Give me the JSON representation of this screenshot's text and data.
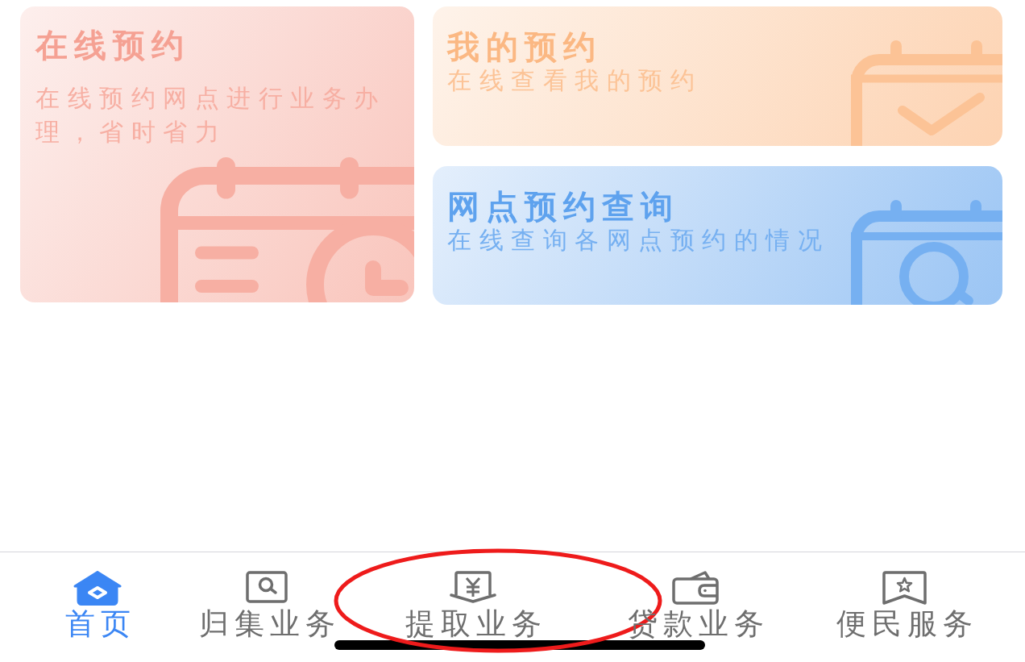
{
  "cards": [
    {
      "title": "在线预约",
      "description": "在线预约网点进行业务办理，省时省力",
      "color": "#f5a193"
    },
    {
      "title": "我的预约",
      "description": "在线查看我的预约",
      "color": "#fbb883"
    },
    {
      "title": "网点预约查询",
      "description": "在线查询各网点预约的情况",
      "color": "#5ea2ee"
    }
  ],
  "tab_bar": {
    "items": [
      {
        "label": "首页",
        "selected": true,
        "circled": false
      },
      {
        "label": "归集业务",
        "selected": false,
        "circled": false
      },
      {
        "label": "提取业务",
        "selected": false,
        "circled": true
      },
      {
        "label": "贷款业务",
        "selected": false,
        "circled": false
      },
      {
        "label": "便民服务",
        "selected": false,
        "circled": false
      }
    ]
  }
}
